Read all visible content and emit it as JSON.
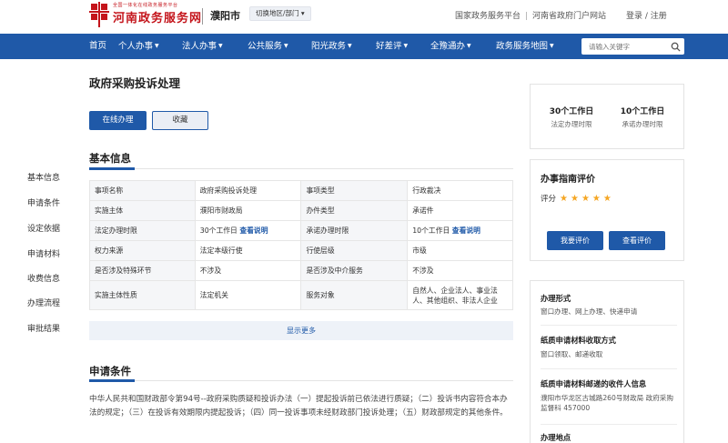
{
  "header": {
    "logo_small": "全国一体化在线政务服务平台",
    "logo_text": "河南政务服务网",
    "city": "濮阳市",
    "switch_label": "切换地区/部门",
    "links": [
      "国家政务服务平台",
      "河南省政府门户网站"
    ],
    "login": "登录 / 注册"
  },
  "nav": {
    "items": [
      {
        "label": "首页",
        "caret": false
      },
      {
        "label": "个人办事",
        "caret": true
      },
      {
        "label": "法人办事",
        "caret": true
      },
      {
        "label": "公共服务",
        "caret": true
      },
      {
        "label": "阳光政务",
        "caret": true
      },
      {
        "label": "好差评",
        "caret": true
      },
      {
        "label": "全豫通办",
        "caret": true
      },
      {
        "label": "政务服务地图",
        "caret": true
      }
    ],
    "search_placeholder": "请输入关键字"
  },
  "sidenav": [
    "基本信息",
    "申请条件",
    "设定依据",
    "申请材料",
    "收费信息",
    "办理流程",
    "审批结果"
  ],
  "page": {
    "title": "政府采购投诉处理",
    "btn_online": "在线办理",
    "btn_fav": "收藏"
  },
  "basic_info": {
    "title": "基本信息",
    "rows": [
      [
        "事项名称",
        "政府采购投诉处理",
        "事项类型",
        "行政裁决"
      ],
      [
        "实施主体",
        "濮阳市财政局",
        "办件类型",
        "承诺件"
      ],
      [
        "法定办理时限",
        "30个工作日",
        "承诺办理时限",
        "10个工作日"
      ],
      [
        "权力来源",
        "法定本级行使",
        "行使层级",
        "市级"
      ],
      [
        "是否涉及特殊环节",
        "不涉及",
        "是否涉及中介服务",
        "不涉及"
      ],
      [
        "实施主体性质",
        "法定机关",
        "服务对象",
        "自然人、企业法人、事业法人、其他组织、非法人企业"
      ]
    ],
    "view_link": "查看说明",
    "show_more": "显示更多"
  },
  "conditions": {
    "title": "申请条件",
    "text": "中华人民共和国财政部令第94号--政府采购质疑和投诉办法（一）提起投诉前已依法进行质疑；（二）投诉书内容符合本办法的规定；（三）在投诉有效期限内提起投诉；（四）同一投诉事项未经财政部门投诉处理；（五）财政部规定的其他条件。"
  },
  "right": {
    "legal_days": "30个工作日",
    "legal_caption": "法定办理时限",
    "promise_days": "10个工作日",
    "promise_caption": "承诺办理时限",
    "eval_title": "办事指南评价",
    "score_label": "评分",
    "stars": "★★★★★",
    "btn_eval": "我要评价",
    "btn_view_eval": "查看评价",
    "form_title": "办理形式",
    "form_text": "窗口办理、网上办理、快递申请",
    "paper_title": "纸质申请材料收取方式",
    "paper_text": "窗口领取、邮递收取",
    "recv_title": "纸质申请材料邮递的收件人信息",
    "recv_text": "濮阳市华龙区古城路260号财政局 政府采购监督科 457000",
    "place_title": "办理地点"
  },
  "colors": {
    "brand_red": "#c4141b",
    "nav_blue": "#1f59a8",
    "star": "#f5a623"
  }
}
